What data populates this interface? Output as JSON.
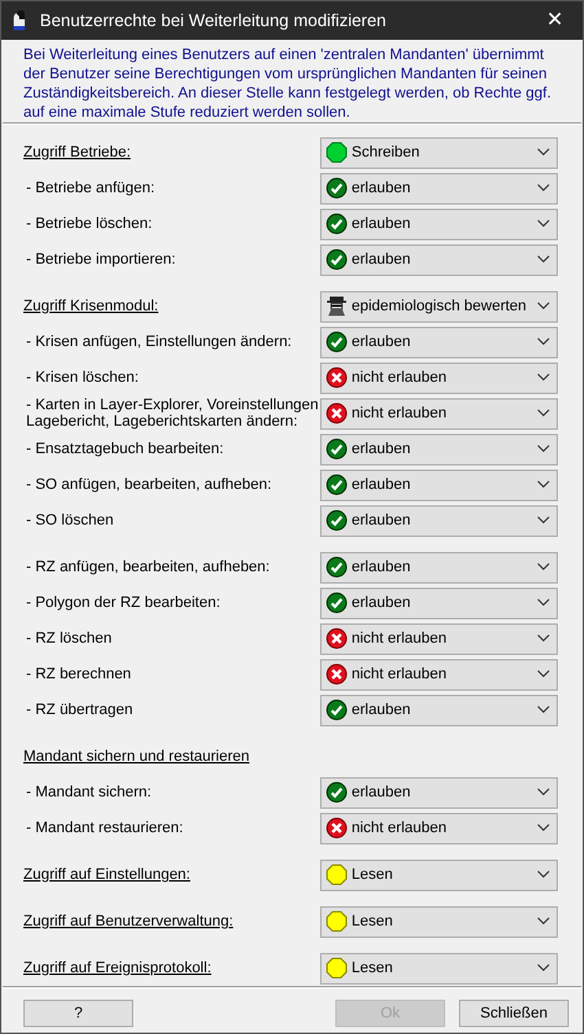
{
  "window": {
    "title": "Benutzerrechte bei Weiterleitung modifizieren",
    "close": "✕"
  },
  "intro": "Bei Weiterleitung eines Benutzers auf einen 'zentralen Mandanten' übernimmt der Benutzer seine Berechtigungen vom ursprünglichen Mandanten für seinen Zuständigkeitsbereich. An dieser Stelle kann festgelegt werden, ob Rechte ggf. auf eine maximale Stufe reduziert werden sollen.",
  "rows": [
    {
      "kind": "section",
      "label": "Zugriff Betriebe:",
      "select": {
        "kind": "write",
        "value": "Schreiben"
      }
    },
    {
      "kind": "item",
      "label": "- Betriebe anfügen:",
      "select": {
        "kind": "allow",
        "value": "erlauben"
      }
    },
    {
      "kind": "item",
      "label": "- Betriebe löschen:",
      "select": {
        "kind": "allow",
        "value": "erlauben"
      }
    },
    {
      "kind": "item",
      "label": "- Betriebe importieren:",
      "select": {
        "kind": "allow",
        "value": "erlauben"
      }
    },
    {
      "kind": "section",
      "label": "Zugriff Krisenmodul:",
      "select": {
        "kind": "agent",
        "value": "epidemiologisch bewerten"
      }
    },
    {
      "kind": "item",
      "label": "- Krisen anfügen, Einstellungen ändern:",
      "select": {
        "kind": "allow",
        "value": "erlauben"
      }
    },
    {
      "kind": "item",
      "label": "- Krisen löschen:",
      "select": {
        "kind": "deny",
        "value": "nicht erlauben"
      }
    },
    {
      "kind": "item",
      "label": "- Karten in Layer-Explorer, Voreinstellungen Lagebericht, Lageberichtskarten ändern:",
      "select": {
        "kind": "deny",
        "value": "nicht erlauben"
      }
    },
    {
      "kind": "item",
      "label": "- Ensatztagebuch bearbeiten:",
      "select": {
        "kind": "allow",
        "value": "erlauben"
      }
    },
    {
      "kind": "item",
      "label": "- SO anfügen, bearbeiten, aufheben:",
      "select": {
        "kind": "allow",
        "value": "erlauben"
      }
    },
    {
      "kind": "item",
      "label": "- SO löschen",
      "select": {
        "kind": "allow",
        "value": "erlauben"
      }
    },
    {
      "kind": "group",
      "label": "- RZ anfügen, bearbeiten, aufheben:",
      "select": {
        "kind": "allow",
        "value": "erlauben"
      }
    },
    {
      "kind": "item",
      "label": "- Polygon der RZ bearbeiten:",
      "select": {
        "kind": "allow",
        "value": "erlauben"
      }
    },
    {
      "kind": "item",
      "label": "- RZ löschen",
      "select": {
        "kind": "deny",
        "value": "nicht erlauben"
      }
    },
    {
      "kind": "item",
      "label": "- RZ berechnen",
      "select": {
        "kind": "deny",
        "value": "nicht erlauben"
      }
    },
    {
      "kind": "item",
      "label": "- RZ übertragen",
      "select": {
        "kind": "allow",
        "value": "erlauben"
      }
    },
    {
      "kind": "heading",
      "label": "Mandant sichern und restaurieren"
    },
    {
      "kind": "item",
      "label": "- Mandant sichern:",
      "select": {
        "kind": "allow",
        "value": "erlauben"
      }
    },
    {
      "kind": "item",
      "label": "- Mandant restaurieren:",
      "select": {
        "kind": "deny",
        "value": "nicht erlauben"
      }
    },
    {
      "kind": "section",
      "label": "Zugriff auf Einstellungen:",
      "select": {
        "kind": "read",
        "value": "Lesen"
      }
    },
    {
      "kind": "section",
      "label": "Zugriff auf Benutzerverwaltung:",
      "select": {
        "kind": "read",
        "value": "Lesen"
      }
    },
    {
      "kind": "section",
      "label": "Zugriff auf Ereignisprotokoll:",
      "select": {
        "kind": "read",
        "value": "Lesen"
      }
    }
  ],
  "buttons": [
    {
      "label": "?",
      "disabled": false
    },
    {
      "label": "Ok",
      "disabled": true
    },
    {
      "label": "Schließen",
      "disabled": false
    }
  ]
}
